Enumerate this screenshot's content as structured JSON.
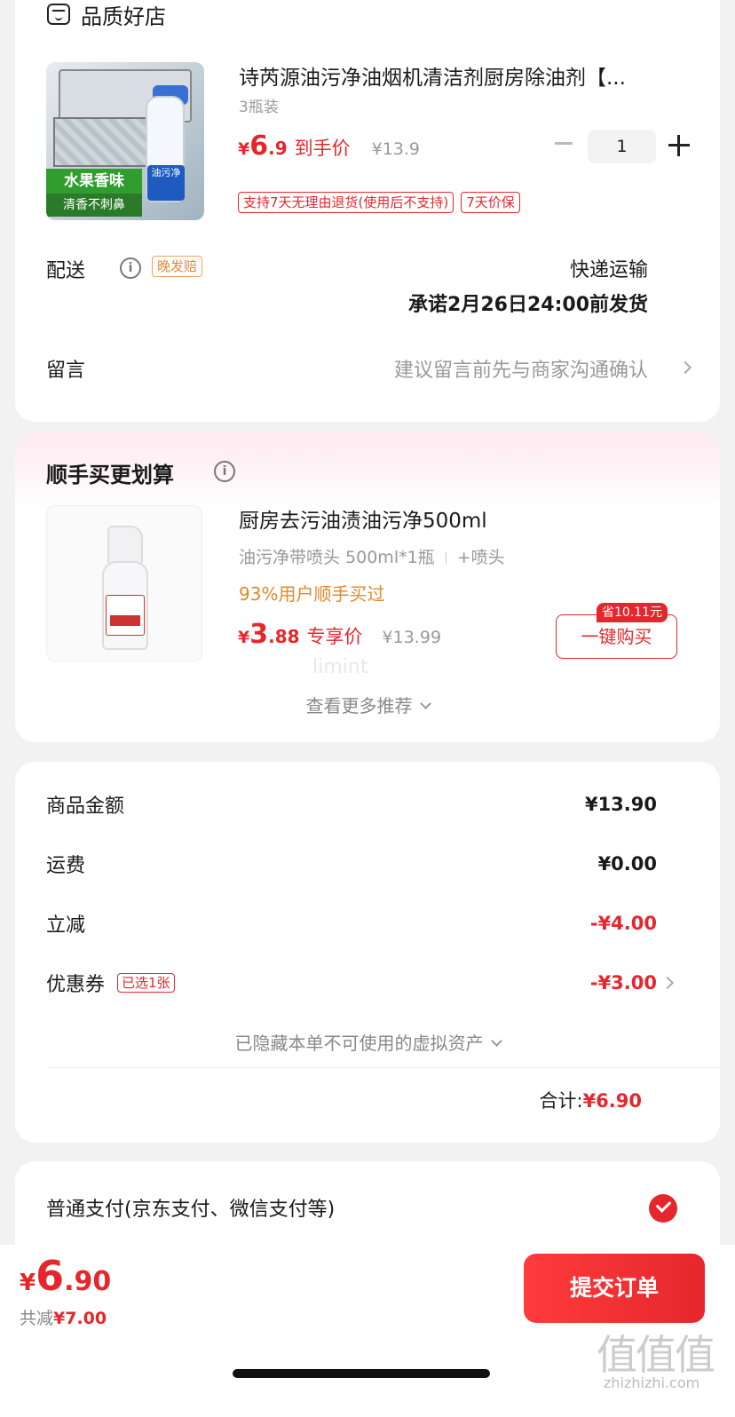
{
  "shop": {
    "name": "品质好店"
  },
  "product": {
    "title": "诗芮源油污净油烟机清洁剂厨房除油剂【...",
    "spec": "3瓶装",
    "image_tags": {
      "scent": "水果香味",
      "tagline": "清香不刺鼻",
      "bottle_label": "油污净"
    },
    "price": {
      "currency": "¥",
      "int": "6",
      "dec": ".9",
      "label": "到手价",
      "original": "¥13.9"
    },
    "quantity": "1",
    "service_tags": [
      "支持7天无理由退货(使用后不支持)",
      "7天价保"
    ]
  },
  "delivery": {
    "label": "配送",
    "late_tag": "晚发赔",
    "method": "快递运输",
    "promise": "承诺2月26日24:00前发货"
  },
  "message": {
    "label": "留言",
    "hint": "建议留言前先与商家沟通确认"
  },
  "recommend": {
    "title": "顺手买更划算",
    "name": "厨房去污油渍油污净500ml",
    "spec": "油污净带喷头 500ml*1瓶",
    "spec_extra": "+喷头",
    "percent": "93%用户顺手买过",
    "price": {
      "currency": "¥",
      "int": "3",
      "dec": ".88",
      "label": "专享价",
      "original": "¥13.99"
    },
    "save_badge": "省10.11元",
    "buy_label": "一键购买",
    "see_more": "查看更多推荐",
    "watermark": "limint"
  },
  "summary": {
    "rows": [
      {
        "label": "商品金额",
        "value": "¥13.90"
      },
      {
        "label": "运费",
        "value": "¥0.00"
      },
      {
        "label": "立减",
        "value": "-¥4.00"
      },
      {
        "label": "优惠券",
        "value": "-¥3.00",
        "tag": "已选1张"
      }
    ],
    "hidden_assets": "已隐藏本单不可使用的虚拟资产",
    "total_label": "合计:",
    "total_value": "¥6.90"
  },
  "payment": {
    "label": "普通支付(京东支付、微信支付等)"
  },
  "bottom": {
    "price": {
      "currency": "¥",
      "int": "6",
      "dec": ".90"
    },
    "saved_label": "共减",
    "saved_value": "¥7.00",
    "submit_label": "提交订单"
  },
  "watermark_site": {
    "glyphs": "值值值",
    "domain": "zhizhizhi.com"
  },
  "colors": {
    "accent": "#e5272d",
    "orange": "#e08a2a",
    "background": "#f2f2f2"
  }
}
